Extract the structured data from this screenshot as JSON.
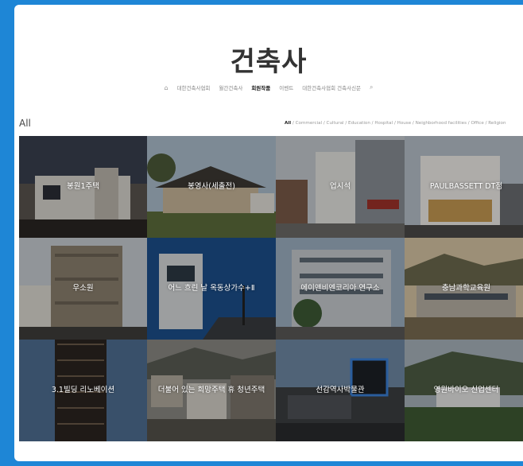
{
  "site": {
    "title": "건축사"
  },
  "nav": {
    "home_icon": "home-icon",
    "items": [
      {
        "label": "대한건축사협회"
      },
      {
        "label": "월간건축사"
      },
      {
        "label": "회원작품"
      },
      {
        "label": "이벤트"
      },
      {
        "label": "대한건축사협회 건축사신문"
      }
    ],
    "active_index": 2,
    "search_icon": "search-icon"
  },
  "section": {
    "title": "All"
  },
  "filters": {
    "items": [
      "All",
      "Commercial",
      "Cultural",
      "Education",
      "Hospital",
      "House",
      "Neighborhood facilities",
      "Office",
      "Religion"
    ]
  },
  "projects": [
    {
      "title": "봉원1주택"
    },
    {
      "title": "봉영사(세출전)"
    },
    {
      "title": "업시석"
    },
    {
      "title": "PAULBASSETT DT점"
    },
    {
      "title": "우소원"
    },
    {
      "title": "어느 흐린 날 옥동상가수+Ⅱ"
    },
    {
      "title": "에이앤비엔코리아 연구소"
    },
    {
      "title": "충남과학교육원"
    },
    {
      "title": "3.1빌딩 리노베이션"
    },
    {
      "title": "더불어 있는 희망주택 휴 청년주택"
    },
    {
      "title": "선감역사박물관"
    },
    {
      "title": "영원바이오 신업센터"
    }
  ],
  "colors": {
    "frame": "#1e86d6",
    "page": "#ffffff"
  }
}
